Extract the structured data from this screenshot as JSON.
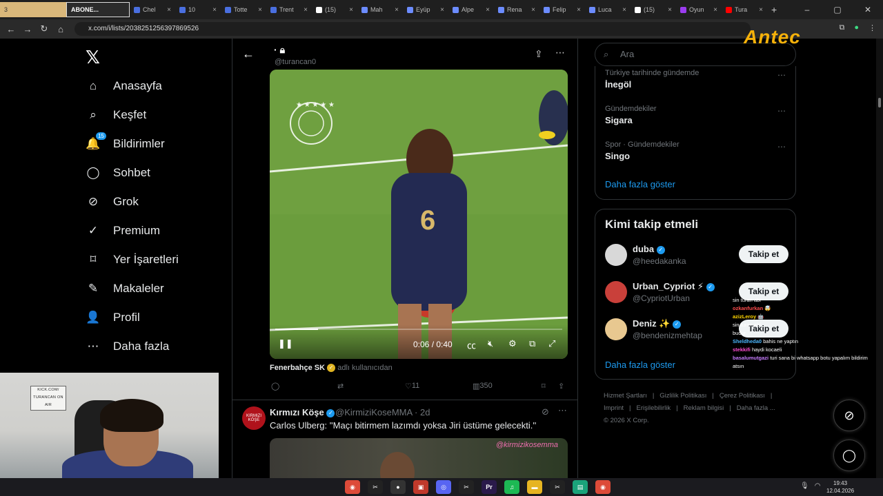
{
  "browser": {
    "tabs": [
      {
        "label": "3",
        "kind": "stream"
      },
      {
        "label": "ABONE...",
        "kind": "abone"
      },
      {
        "label": "Chel",
        "color": "#4a6fe0"
      },
      {
        "label": "10",
        "color": "#4a6fe0"
      },
      {
        "label": "Totte",
        "color": "#4a6fe0"
      },
      {
        "label": "Trent",
        "color": "#4a6fe0"
      },
      {
        "label": "(15)",
        "color": "#ffffff"
      },
      {
        "label": "Mah",
        "color": "#6c8cff"
      },
      {
        "label": "Eyüp",
        "color": "#6c8cff"
      },
      {
        "label": "Alpe",
        "color": "#6c8cff"
      },
      {
        "label": "Rena",
        "color": "#6c8cff"
      },
      {
        "label": "Felip",
        "color": "#6c8cff"
      },
      {
        "label": "Luca",
        "color": "#6c8cff"
      },
      {
        "label": "(15)",
        "color": "#ffffff"
      },
      {
        "label": "Oyun",
        "color": "#9b3cf0"
      },
      {
        "label": "Tura",
        "color": "#ff0000"
      }
    ],
    "url": "x.com/i/lists/2038251256397869526"
  },
  "sidebar": {
    "items": [
      {
        "label": "Anasayfa",
        "icon": "home-icon",
        "glyph": "⌂"
      },
      {
        "label": "Keşfet",
        "icon": "search-icon",
        "glyph": "⌕"
      },
      {
        "label": "Bildirimler",
        "icon": "bell-icon",
        "glyph": "🔔",
        "badge": "15"
      },
      {
        "label": "Sohbet",
        "icon": "chat-icon",
        "glyph": "◯"
      },
      {
        "label": "Grok",
        "icon": "grok-icon",
        "glyph": "⊘"
      },
      {
        "label": "Premium",
        "icon": "premium-icon",
        "glyph": "✓"
      },
      {
        "label": "Yer İşaretleri",
        "icon": "bookmark-icon",
        "glyph": "⌑"
      },
      {
        "label": "Makaleler",
        "icon": "article-icon",
        "glyph": "✎"
      },
      {
        "label": "Profil",
        "icon": "profile-icon",
        "glyph": "👤"
      },
      {
        "label": "Daha fazla",
        "icon": "more-icon",
        "glyph": "⋯"
      }
    ]
  },
  "tweet1": {
    "header_title": "·",
    "header_handle": "@turancan0",
    "video": {
      "time": "0:06 / 0:40",
      "progress": 0.15
    },
    "source_name": "Fenerbahçe SK",
    "source_suffix": "adlı kullanıcıdan",
    "likes": "11",
    "views": "350"
  },
  "tweet2": {
    "avatar_text": "KIRMIZI KÖŞE",
    "name": "Kırmızı Köşe",
    "handle": "@KirmiziKoseMMA · 2d",
    "text": "Carlos Ulberg: ''Maçı bitirmem lazımdı yoksa Jiri üstüme gelecekti.''",
    "media_tag": "@kirmizikosemma"
  },
  "search": {
    "placeholder": "Ara"
  },
  "trends": [
    {
      "meta": "Türkiye tarihinde gündemde",
      "name": "İnegöl"
    },
    {
      "meta": "Gündemdekiler",
      "name": "Sigara"
    },
    {
      "meta": "Spor · Gündemdekiler",
      "name": "Singo"
    }
  ],
  "trends_show_more": "Daha fazla göster",
  "who_to_follow": {
    "title": "Kimi takip etmeli",
    "users": [
      {
        "name": "duba",
        "handle": "@heedakanka",
        "button": "Takip et",
        "avatar_color": "#d8d8d8"
      },
      {
        "name": "Urban_Cypriot ⚡",
        "handle": "@CypriotUrban",
        "button": "Takip et",
        "avatar_color": "#c9403a"
      },
      {
        "name": "Deniz ✨",
        "handle": "@bendenizmehtap",
        "button": "Takip et",
        "avatar_color": "#e8c890"
      }
    ],
    "show_more": "Daha fazla göster"
  },
  "footer": {
    "links": [
      "Hizmet Şartları",
      "Gizlilik Politikası",
      "Çerez Politikası",
      "Imprint",
      "Erişilebilirlik",
      "Reklam bilgisi",
      "Daha fazla ..."
    ],
    "copyright": "© 2026 X Corp."
  },
  "overlay": {
    "brand": "Antec",
    "chat": [
      {
        "user": "",
        "text": "sin turan abi",
        "color": "#3ddc84"
      },
      {
        "user": "ozkanfurkan",
        "text": "🤯",
        "color": "#ff4d4d"
      },
      {
        "user": "azizLeroy",
        "text": "🤖",
        "color": "#ffd400"
      },
      {
        "user": "",
        "text": "sin turan abi",
        "color": "#3ddc84"
      },
      {
        "user": "",
        "text": "budur",
        "color": "#ff4d4d"
      },
      {
        "user": "Sheldheda0",
        "text": "bahis ne yaptın",
        "color": "#4db8ff"
      },
      {
        "user": "stekkifi",
        "text": "haydi kocaeli",
        "color": "#ff4dd2"
      },
      {
        "user": "basalumutgazi",
        "text": "turi sana bi whatsapp botu yapalım bildirim atsın",
        "color": "#c77dff"
      }
    ],
    "webcam_sign": "KICK.COM/ TURANCAN ON AIR"
  },
  "taskbar": {
    "apps": [
      {
        "icon": "chrome-icon",
        "glyph": "◉",
        "color": "#dd4b39"
      },
      {
        "icon": "capcut-icon",
        "glyph": "✂",
        "color": "#222"
      },
      {
        "icon": "obs-icon",
        "glyph": "●",
        "color": "#333"
      },
      {
        "icon": "app-red-icon",
        "glyph": "▣",
        "color": "#c0392b"
      },
      {
        "icon": "discord-icon",
        "glyph": "◎",
        "color": "#5865f2"
      },
      {
        "icon": "capcut2-icon",
        "glyph": "✂",
        "color": "#222"
      },
      {
        "icon": "premiere-icon",
        "glyph": "Pr",
        "color": "#2a1a4a"
      },
      {
        "icon": "spotify-icon",
        "glyph": "♫",
        "color": "#1db954"
      },
      {
        "icon": "folder-icon",
        "glyph": "▬",
        "color": "#e6b422"
      },
      {
        "icon": "capcut3-icon",
        "glyph": "✂",
        "color": "#222"
      },
      {
        "icon": "app-green-icon",
        "glyph": "▤",
        "color": "#1aa37a"
      },
      {
        "icon": "chrome2-icon",
        "glyph": "◉",
        "color": "#dd4b39"
      }
    ],
    "time": "19:43",
    "date": "12.04.2026"
  }
}
